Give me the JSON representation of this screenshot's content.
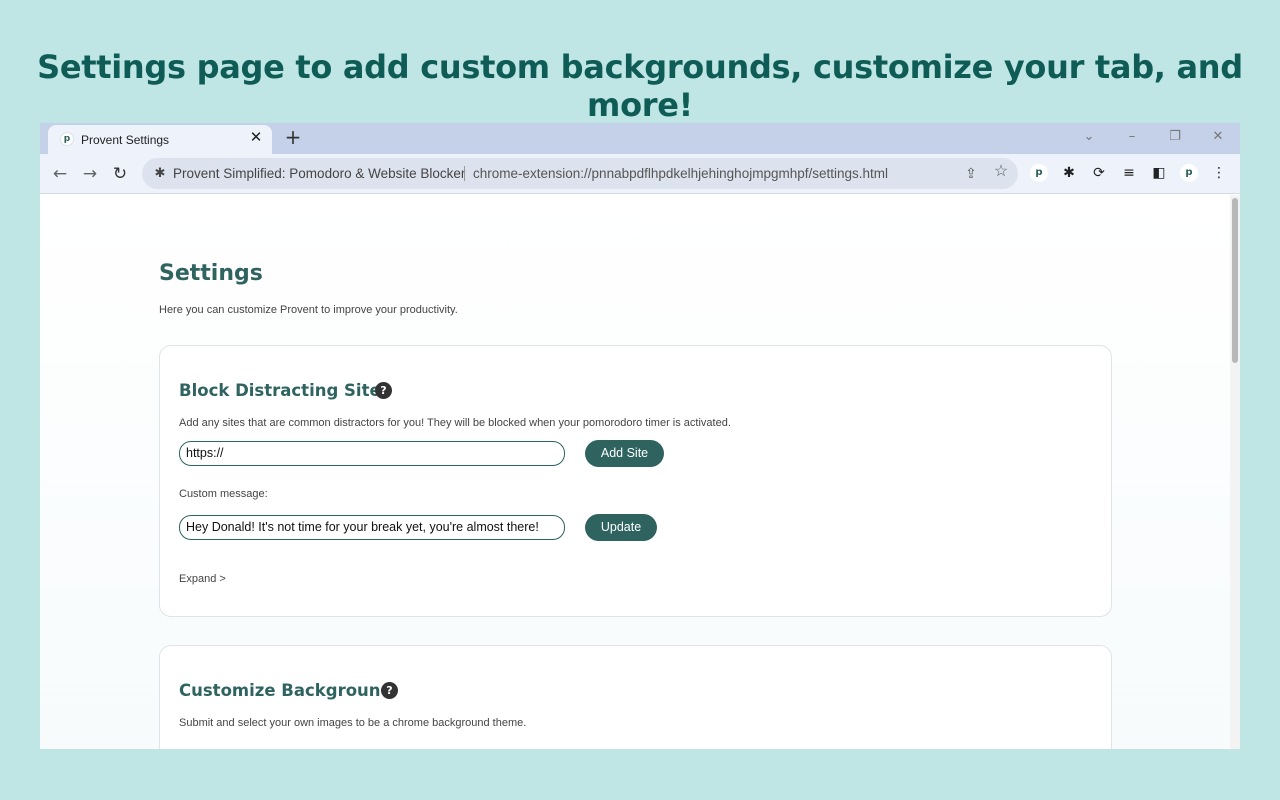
{
  "headline": "Settings page to add custom backgrounds, customize your tab, and more!",
  "browser": {
    "tab": {
      "favicon": "p",
      "title": "Provent Settings",
      "close": "✕"
    },
    "new_tab": "+",
    "window_controls": {
      "dropdown": "⌄",
      "minimize": "–",
      "restore": "❐",
      "close": "✕"
    },
    "nav": {
      "back": "←",
      "forward": "→",
      "reload": "↻"
    },
    "omnibox": {
      "origin": "Provent Simplified: Pomodoro & Website Blocker",
      "url": "chrome-extension://pnnabpdflhpdkelhjehinghojmpgmhpf/settings.html"
    },
    "extensions": {
      "provent": "p",
      "puzzle": "✱",
      "cycle": "⟳",
      "media": "≡",
      "sidepanel": "◧",
      "profile": "p",
      "menu": "⋮"
    }
  },
  "page": {
    "title": "Settings",
    "subtitle": "Here you can customize Provent to improve your productivity.",
    "block_sites": {
      "title": "Block Distracting Sites",
      "help": "?",
      "description": "Add any sites that are common distractors for you! They will be blocked when your pomorodoro timer is activated.",
      "site_input_value": "https://",
      "add_button": "Add Site",
      "custom_message_label": "Custom message:",
      "message_input_value": "Hey Donald! It's not time for your break yet, you're almost there!",
      "update_button": "Update",
      "expand": "Expand >"
    },
    "background": {
      "title": "Customize Background",
      "help": "?",
      "description": "Submit and select your own images to be a chrome background theme."
    }
  }
}
